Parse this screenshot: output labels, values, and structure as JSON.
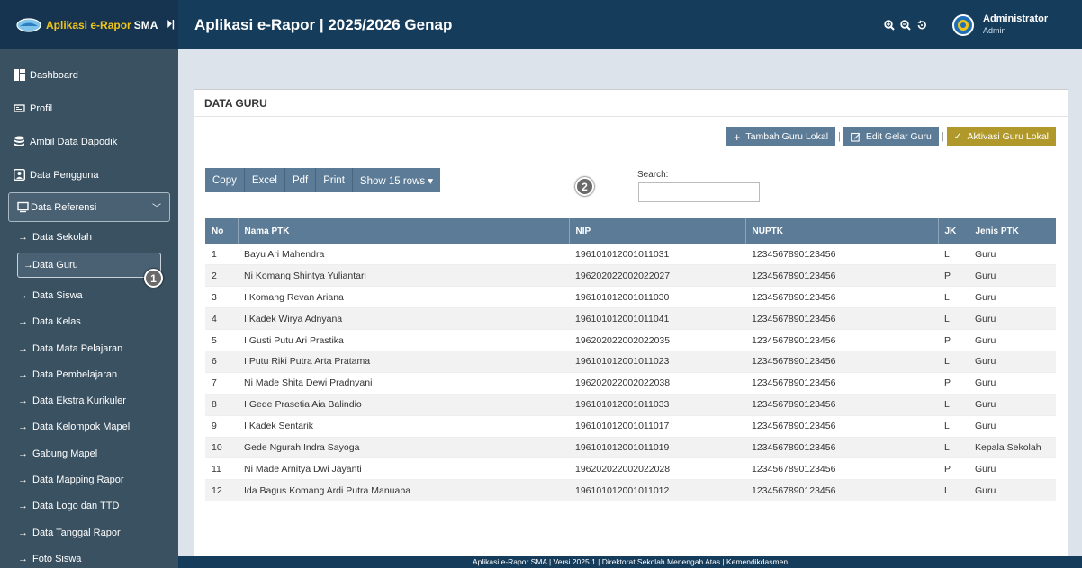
{
  "brand": {
    "part1": "Aplikasi e-Rapor",
    "part2": "SMA",
    "toggle": "⏵|"
  },
  "header": {
    "title": "Aplikasi e-Rapor | 2025/2026 Genap"
  },
  "user": {
    "name": "Administrator",
    "role": "Admin"
  },
  "sidebar": {
    "top_items": [
      {
        "label": "Dashboard",
        "icon": "dashboard-icon"
      },
      {
        "label": "Profil",
        "icon": "id-card-icon"
      },
      {
        "label": "Ambil Data Dapodik",
        "icon": "database-icon"
      },
      {
        "label": "Data Pengguna",
        "icon": "users-icon"
      }
    ],
    "group": {
      "label": "Data Referensi",
      "icon": "monitor-icon"
    },
    "sub_items": [
      "Data Sekolah",
      "Data Guru",
      "Data Siswa",
      "Data Kelas",
      "Data Mata Pelajaran",
      "Data Pembelajaran",
      "Data Ekstra Kurikuler",
      "Data Kelompok Mapel",
      "Gabung Mapel",
      "Data Mapping Rapor",
      "Data Logo dan TTD",
      "Data Tanggal Rapor",
      "Foto Siswa"
    ],
    "active": "Data Guru",
    "marker": "1"
  },
  "card": {
    "title": "DATA GURU",
    "buttons": {
      "tambah": "Tambah Guru Lokal",
      "edit": "Edit Gelar Guru",
      "aktivasi": "Aktivasi Guru Lokal",
      "separator": "|"
    },
    "dt_buttons": [
      "Copy",
      "Excel",
      "Pdf",
      "Print",
      "Show 15 rows ▾"
    ],
    "search_label": "Search:",
    "search_value": "",
    "marker": "2"
  },
  "table": {
    "headers": [
      "No",
      "Nama PTK",
      "NIP",
      "NUPTK",
      "JK",
      "Jenis PTK"
    ],
    "rows": [
      [
        "1",
        "Bayu Ari Mahendra",
        "196101012001011031",
        "1234567890123456",
        "L",
        "Guru"
      ],
      [
        "2",
        "Ni Komang Shintya Yuliantari",
        "196202022002022027",
        "1234567890123456",
        "P",
        "Guru"
      ],
      [
        "3",
        "I Komang Revan Ariana",
        "196101012001011030",
        "1234567890123456",
        "L",
        "Guru"
      ],
      [
        "4",
        "I Kadek Wirya Adnyana",
        "196101012001011041",
        "1234567890123456",
        "L",
        "Guru"
      ],
      [
        "5",
        "I Gusti Putu Ari Prastika",
        "196202022002022035",
        "1234567890123456",
        "P",
        "Guru"
      ],
      [
        "6",
        "I Putu Riki Putra Arta Pratama",
        "196101012001011023",
        "1234567890123456",
        "L",
        "Guru"
      ],
      [
        "7",
        "Ni Made Shita Dewi Pradnyani",
        "196202022002022038",
        "1234567890123456",
        "P",
        "Guru"
      ],
      [
        "8",
        "I Gede Prasetia Aia Balindio",
        "196101012001011033",
        "1234567890123456",
        "L",
        "Guru"
      ],
      [
        "9",
        "I Kadek Sentarik",
        "196101012001011017",
        "1234567890123456",
        "L",
        "Guru"
      ],
      [
        "10",
        "Gede Ngurah Indra Sayoga",
        "196101012001011019",
        "1234567890123456",
        "L",
        "Kepala Sekolah"
      ],
      [
        "11",
        "Ni Made Arnitya Dwi Jayanti",
        "196202022002022028",
        "1234567890123456",
        "P",
        "Guru"
      ],
      [
        "12",
        "Ida Bagus Komang Ardi Putra Manuaba",
        "196101012001011012",
        "1234567890123456",
        "L",
        "Guru"
      ]
    ]
  },
  "footer": {
    "text": "Aplikasi e-Rapor SMA | Versi 2025.1 | Direktorat Sekolah Menengah Atas | Kemendikdasmen"
  },
  "colors": {
    "topbar": "#163c5b",
    "sidebar": "#3a5161",
    "button": "#5b7b96",
    "button_olive": "#b0982a"
  }
}
